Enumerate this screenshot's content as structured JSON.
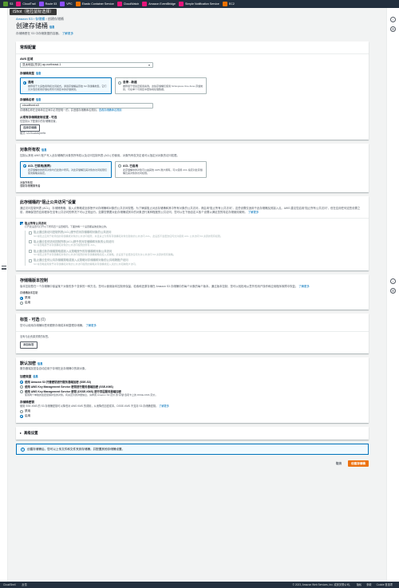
{
  "topbar": {
    "services": [
      {
        "label": "S3",
        "color": "#569a31"
      },
      {
        "label": "CloudTrail",
        "color": "#e7157b"
      },
      {
        "label": "Route 53",
        "color": "#8c4fff"
      },
      {
        "label": "VPC",
        "color": "#8c4fff"
      },
      {
        "label": "Elastic Container Service",
        "color": "#ed7100"
      },
      {
        "label": "CloudWatch",
        "color": "#e7157b"
      },
      {
        "label": "Amazon EventBridge",
        "color": "#e7157b"
      },
      {
        "label": "Simple Notification Service",
        "color": "#e7157b"
      },
      {
        "label": "EC2",
        "color": "#ed7100"
      }
    ]
  },
  "overlay": {
    "ishot": "iShot（拖拉鼠标选择）"
  },
  "breadcrumb": {
    "root": "Amazon S3",
    "sep1": "›",
    "mid": "存储桶",
    "sep2": "›",
    "current": "创建存储桶"
  },
  "page": {
    "title": "创建存储桶",
    "info": "信息",
    "subtitle": "存储桶是在 S3 中存储数据的容器。",
    "learn_more": "了解更多"
  },
  "general": {
    "title": "常规配置",
    "region_label": "AWS 区域",
    "region_value": "亚太地区(东京) ap-northeast-1",
    "type_label": "存储桶类型",
    "type_info": "信息",
    "type_general_title": "通用",
    "type_general_desc": "推荐用于大多数用例和访问模式。通用存储桶是原始 S3 存储桶类型。它们允许混合使用存储在所有可用区中的存储类别。",
    "type_directory_title": "目录 - 新建",
    "type_directory_desc": "推荐用于低延迟使用案例。这些存储桶仅使用 S3 Express One Zone 存储类别，可在单个可用区中更快地处理数据。",
    "name_label": "存储桶名称",
    "name_info": "信息",
    "name_value": "cloudfront-s3",
    "name_hint": "存储桶名称在全局命名空间中必须是唯一的，并遵循存储桶命名规则。",
    "name_rules": "查看存储桶命名规则",
    "copy_label": "从现有存储桶复制设置 - 可选",
    "copy_desc": "仅复制以下配置中的存储桶设置。",
    "copy_button": "选择存储桶",
    "copy_format": "格式: s3://bucket/prefix"
  },
  "ownership": {
    "title": "对象所有权",
    "info": "信息",
    "desc": "控制从其他 AWS 账户写入此存储桶的对象的所有权以及访问控制列表 (ACL) 的使用。对象所有权决定谁可以指定对对象的访问权限。",
    "disabled_title": "ACL 已禁用(推荐)",
    "disabled_desc": "此存储桶中的所有对象均归此账户所有。对此存储桶及其对象的访问权限仅使用策略来指定。",
    "enabled_title": "ACL 已启用",
    "enabled_desc": "此存储桶中的对象可以由其他 AWS 账户拥有。可以使用 ACL 指定对此存储桶及其对象的访问权限。",
    "owner_label": "对象所有权",
    "owner_value": "强制存储桶拥有者"
  },
  "public_access": {
    "title": "此存储桶的“阻止公共访问”设置",
    "desc": "通过访问控制列表 (ACL)、存储桶策略、接入点策略或全部授予对存储桶和对象的公共访问权限。为了确保阻止对此存储桶和其中所有对象的公共访问，请启用“阻止所有公共访问”。这些设置仅适用于此存储桶及其接入点。AWS 建议您启用“阻止所有公共访问”，但在应用任何这些设置之前，请确保您的应用程序在没有公共访问的情况下可以正常运行。如果您需要对此存储桶或其中的对象进行某种程度的公共访问，您可以在下面自定义各个设置以满足您的特定存储使用案例。",
    "learn_more": "了解更多",
    "block_all_title": "阻止所有公共访问",
    "block_all_desc": "打开此设置与打开以下所有四个设置相同。下面的每一个设置都是彼此独立的。",
    "items": [
      {
        "title": "阻止通过新访问控制列表(ACL)授予的对存储桶和对象的公共访问",
        "desc": "S3 将阻止应用于新添加的存储桶或对象的公共访问权限，并且禁止为现有存储桶和对象创建新的公共访问 ACL。此设置不会更改任何允许使用 ACL 公共访问 S3 资源的现有权限。"
      },
      {
        "title": "阻止通过任何访问控制列表(ACL)授予的对存储桶和对象的公共访问",
        "desc": "S3 将忽略授予对存储桶和对象的公共访问权限的所有 ACL。"
      },
      {
        "title": "阻止通过新存储桶策略或接入点策略授予的存储桶和对象公共访问",
        "desc": "S3 将阻止授予对存储桶和对象的公共访问权限的新存储桶策略和接入点策略。此设置不会更改任何允许公共访问 S3 资源的现有策略。"
      },
      {
        "title": "阻止通过任何公共存储桶策略或接入点策略对存储桶和对象的公共和跨账户访问",
        "desc": "S3 将忽略使用授予对存储桶和对象的公共访问权限的策略对存储桶或接入点的公共和跨账户访问。"
      }
    ]
  },
  "versioning": {
    "title": "存储桶版本控制",
    "desc": "版本控制是在一个存储桶中保留某个对象的多个变体的一种方法。您可以使用版本控制来保留、检索和还原存储在 Amazon S3 存储桶中的每个对象的每个版本。通过版本控制，您可以轻松地从意外的用户操作和应用程序故障中恢复。",
    "learn_more": "了解更多",
    "label": "存储桶版本控制",
    "opt_disable": "禁用",
    "opt_enable": "启用"
  },
  "tags": {
    "title": "标签 - 可选",
    "count": "(0)",
    "desc": "您可以使用存储桶标签来跟踪存储成本和整理存储桶。",
    "learn_more": "了解更多",
    "empty": "没有与此资源关联的标签。",
    "add_button": "添加标签"
  },
  "encryption": {
    "title": "默认加密",
    "info": "信息",
    "desc": "服务器端加密会自动应用于存储在此存储桶中的新对象。",
    "type_label": "加密类型",
    "type_info": "信息",
    "opt1": "使用 Amazon S3 托管密钥进行服务器端加密 (SSE-S3)",
    "opt2": "使用 AWS Key Management Service 密钥进行服务器端加密 (SSE-KMS)",
    "opt3": "使用 AWS Key Management Service 密钥 (DSSE-KMS) 进行双层服务器端加密",
    "opt3_desc": "使用两个单独的加密层保护您的对象。有关定价的详细信息，请参阅 Amazon S3 定价 的“存储”选项卡上的 DSSE-KMS 定价。",
    "key_label": "存储桶密钥",
    "key_desc": "使用 SSE-KMS 的 S3 存储桶密钥可以降低对 AWS KMS 的调用，从而降低加密成本。DSSE-KMS 不支持 S3 存储桶密钥。",
    "key_learn": "了解更多",
    "key_disable": "禁用",
    "key_enable": "启用"
  },
  "advanced": {
    "title": "高级设置"
  },
  "alert": {
    "text": "创建存储桶后，您可以上传文件和文件夹到存储桶，并配置其他存储桶设置。"
  },
  "actions": {
    "cancel": "取消",
    "create": "创建存储桶"
  },
  "footer": {
    "cloudshell": "CloudShell",
    "feedback": "反馈",
    "copyright": "© 2023, Amazon Web Services, Inc. 或其关联公司。",
    "privacy": "隐私",
    "terms": "条款",
    "cookie": "Cookie 首选项"
  }
}
